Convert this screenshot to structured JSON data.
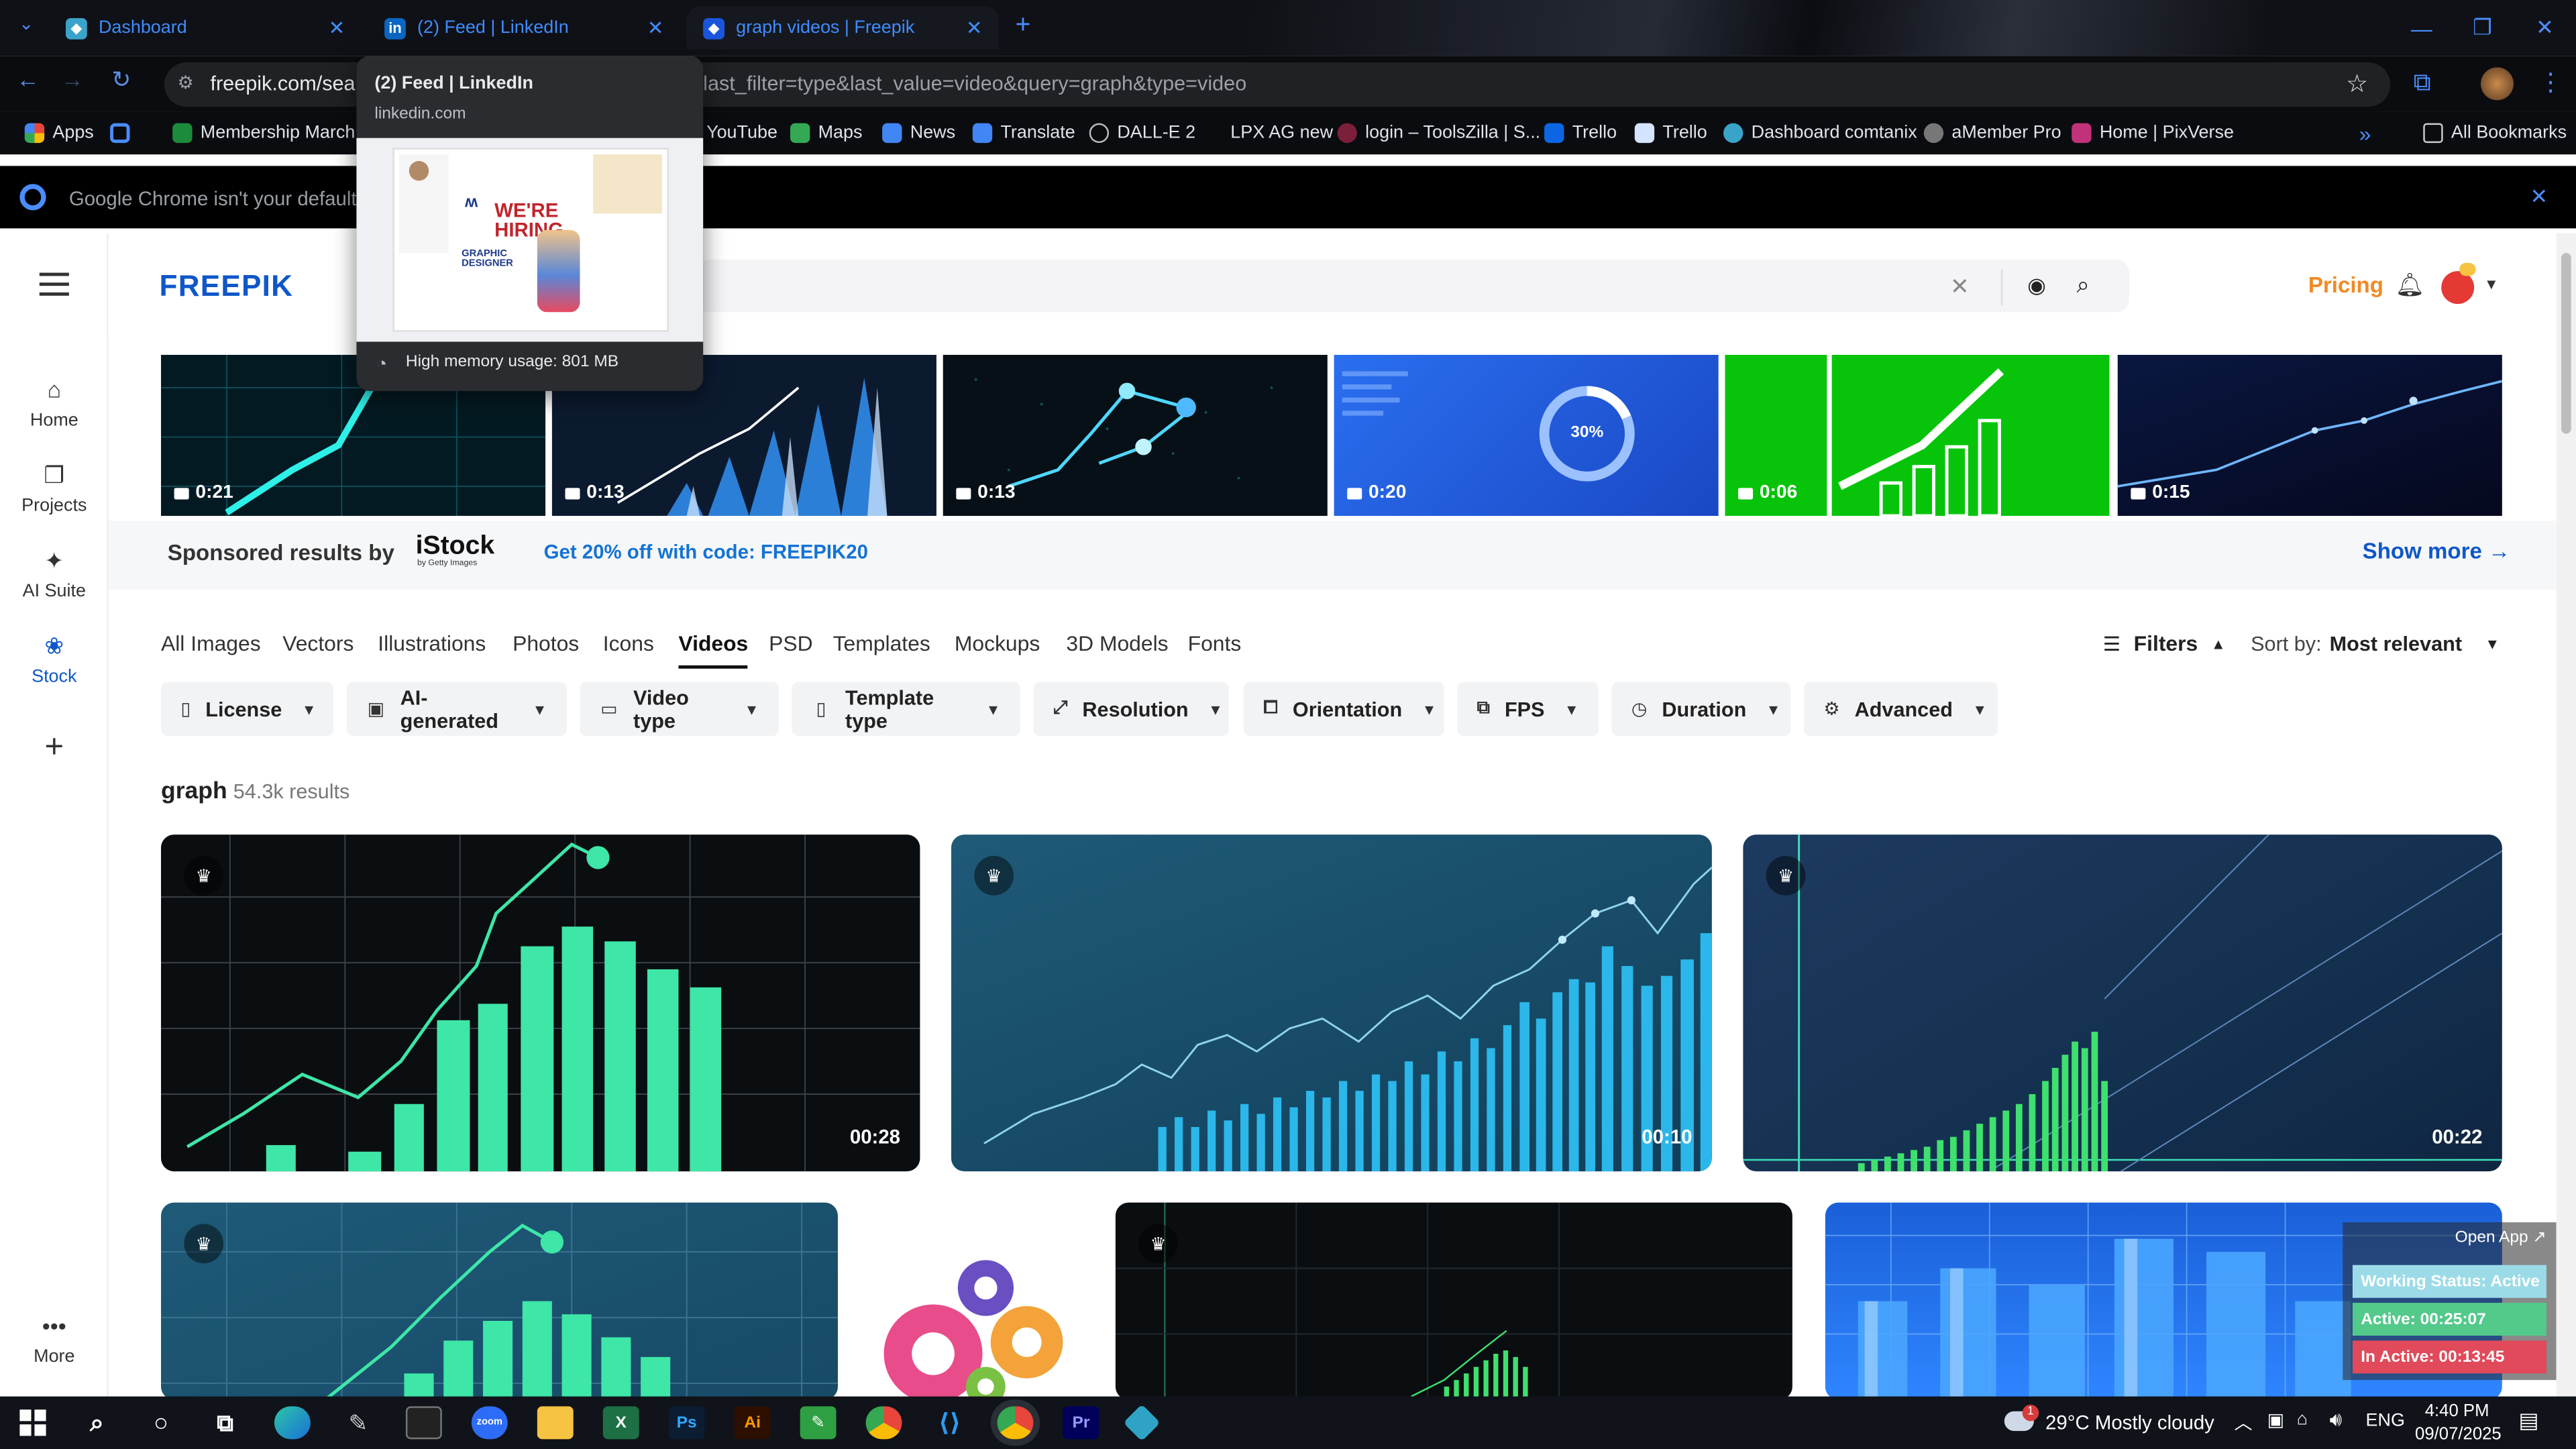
{
  "browser": {
    "tabs": [
      {
        "title": "Dashboard",
        "icon": "dashboard-icon"
      },
      {
        "title": "(2) Feed | LinkedIn",
        "icon": "linkedin-icon"
      },
      {
        "title": "graph videos | Freepik",
        "icon": "freepik-icon"
      }
    ],
    "url_host": "freepik.com/searc",
    "url_rest": "last_filter=type&last_value=video&query=graph&type=video",
    "tooltip": {
      "title": "(2) Feed | LinkedIn",
      "domain": "linkedin.com",
      "preview_headline": "WE'RE HIRING",
      "preview_sub": "GRAPHIC DESIGNER",
      "memory": "High memory usage: 801 MB"
    },
    "bookmarks": [
      {
        "label": "Apps",
        "color": "#e8453c"
      },
      {
        "label": "",
        "color": "#4a8dff"
      },
      {
        "label": "Membership March...",
        "color": "#1c8b3c"
      },
      {
        "label": "YouTube",
        "color": "#ff0000"
      },
      {
        "label": "Maps",
        "color": "#34a853"
      },
      {
        "label": "News",
        "color": "#4285f4"
      },
      {
        "label": "Translate",
        "color": "#4285f4"
      },
      {
        "label": "DALL-E 2",
        "color": "#555555"
      },
      {
        "label": "LPX AG new",
        "color": "#0b0c10"
      },
      {
        "label": "login – ToolsZilla | S...",
        "color": "#7b1f3a"
      },
      {
        "label": "Trello",
        "color": "#0c66e4"
      },
      {
        "label": "Trello",
        "color": "#0c66e4"
      },
      {
        "label": "Dashboard comtanix",
        "color": "#3aa3c9"
      },
      {
        "label": "aMember Pro",
        "color": "#777777"
      },
      {
        "label": "Home | PixVerse",
        "color": "#c2327a"
      }
    ],
    "all_bookmarks": "All Bookmarks",
    "default_banner": "Google Chrome isn't your default bro"
  },
  "freepik": {
    "logo": "FREEPIK",
    "nav": [
      "Home",
      "Projects",
      "AI Suite",
      "Stock",
      "",
      "More"
    ],
    "pricing": "Pricing",
    "sponsored_label": "Sponsored results by",
    "istock": "iStock",
    "istock_sub": "by Getty Images",
    "promo": "Get 20% off with code: FREEPIK20",
    "show_more": "Show more →",
    "sponsored_durations": [
      "0:21",
      "0:13",
      "0:13",
      "0:20",
      "0:06",
      "0:15"
    ],
    "percent_label": "30%",
    "categories": [
      "All Images",
      "Vectors",
      "Illustrations",
      "Photos",
      "Icons",
      "Videos",
      "PSD",
      "Templates",
      "Mockups",
      "3D Models",
      "Fonts"
    ],
    "active_category": "Videos",
    "filters_label": "Filters",
    "sort_label": "Sort by:",
    "sort_value": "Most relevant",
    "filter_buttons": [
      "License",
      "AI-generated",
      "Video type",
      "Template type",
      "Resolution",
      "Orientation",
      "FPS",
      "Duration",
      "Advanced"
    ],
    "query": "graph",
    "results": "54.3k results",
    "durations": [
      "00:28",
      "00:10",
      "00:22"
    ]
  },
  "widget": {
    "open_app": "Open App ↗",
    "status": "Working Status: Active",
    "active": "Active: 00:25:07",
    "inactive": "In Active: 00:13:45"
  },
  "taskbar": {
    "weather": "29°C  Mostly cloudy",
    "weather_badge": "1",
    "lang": "ENG",
    "time": "4:40 PM",
    "date": "09/07/2025"
  },
  "colors": {
    "accent": "#0f57c9",
    "pricing": "#f08a24",
    "green": "#3ee6a8",
    "chrome_blue": "#3f8cff"
  }
}
